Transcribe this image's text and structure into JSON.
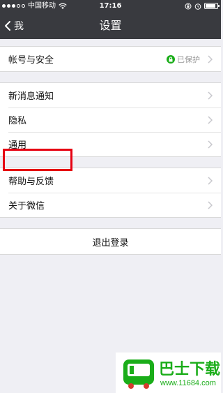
{
  "status_bar": {
    "carrier": "中国移动",
    "time": "17:16",
    "signal_bars_filled": 3,
    "signal_bars_total": 5,
    "battery_level": 0.8
  },
  "nav": {
    "back_label": "我",
    "title": "设置"
  },
  "groups": {
    "account": {
      "label": "帐号与安全",
      "status": "已保护"
    },
    "general": [
      {
        "label": "新消息通知"
      },
      {
        "label": "隐私"
      },
      {
        "label": "通用"
      }
    ],
    "about": [
      {
        "label": "帮助与反馈"
      },
      {
        "label": "关于微信"
      }
    ]
  },
  "logout_label": "退出登录",
  "watermark": {
    "name": "巴士下载",
    "url": "www.11684.com"
  },
  "colors": {
    "navbar": "#393a3f",
    "background": "#efeff4",
    "accent_green": "#1aad19",
    "highlight_red": "#e60012"
  },
  "icons": [
    "back-chevron-icon",
    "lock-icon",
    "chevron-right-icon",
    "wifi-icon",
    "alarm-icon",
    "battery-icon"
  ]
}
